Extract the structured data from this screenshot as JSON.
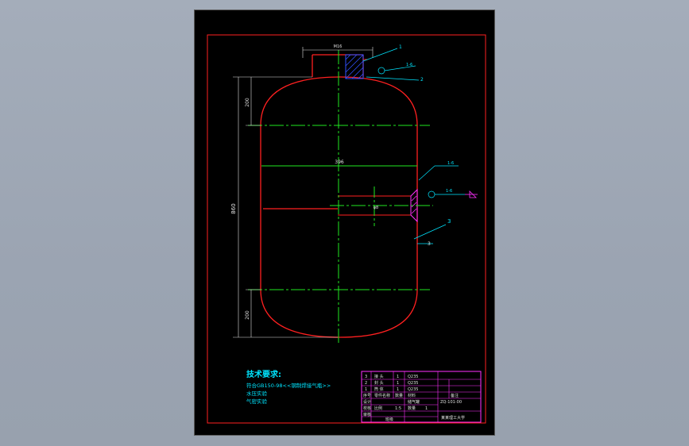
{
  "colors": {
    "background": "#000000",
    "frame": "#ff2020",
    "centerline": "#21e821",
    "dimension": "#e0e0e0",
    "text_cyan": "#00e5ff",
    "title_block": "#ff30ff",
    "hatch": "#3050ff"
  },
  "drawing": {
    "dims": {
      "neck_width": "M16",
      "overall_height": "860",
      "top_head_height": "200",
      "bottom_head_height": "200",
      "body_width": "396",
      "nozzle_label": "φ8"
    },
    "leaders": [
      "1",
      "2",
      "3"
    ],
    "weld_label_top": "1-6",
    "weld_label_right_top": "1-6",
    "weld_label_right": "1-6",
    "weld_dim": "3"
  },
  "tech_req": {
    "heading": "技术要求:",
    "lines": [
      "符合GB150-98<<钢制焊接气瓶>>",
      "水压实验",
      "气密实验"
    ]
  },
  "title_block": {
    "rows": [
      [
        "3",
        "接 头",
        "1",
        "",
        "Q235"
      ],
      [
        "2",
        "封 头",
        "1",
        "",
        "Q235"
      ],
      [
        "1",
        "筒 体",
        "1",
        "",
        "Q235"
      ]
    ],
    "header": [
      "序号",
      "零件名称",
      "数量",
      "材料",
      "备注"
    ],
    "cells": {
      "drawing_name": "储气罐",
      "drawing_no": "ZQ-101-00",
      "scale_label": "比例",
      "scale_value": "1:5",
      "qty_label": "数量",
      "qty_value": "1",
      "designer": "设计",
      "checker": "校核",
      "approver": "审核",
      "school": "某某理工大学",
      "class": "班级"
    }
  }
}
